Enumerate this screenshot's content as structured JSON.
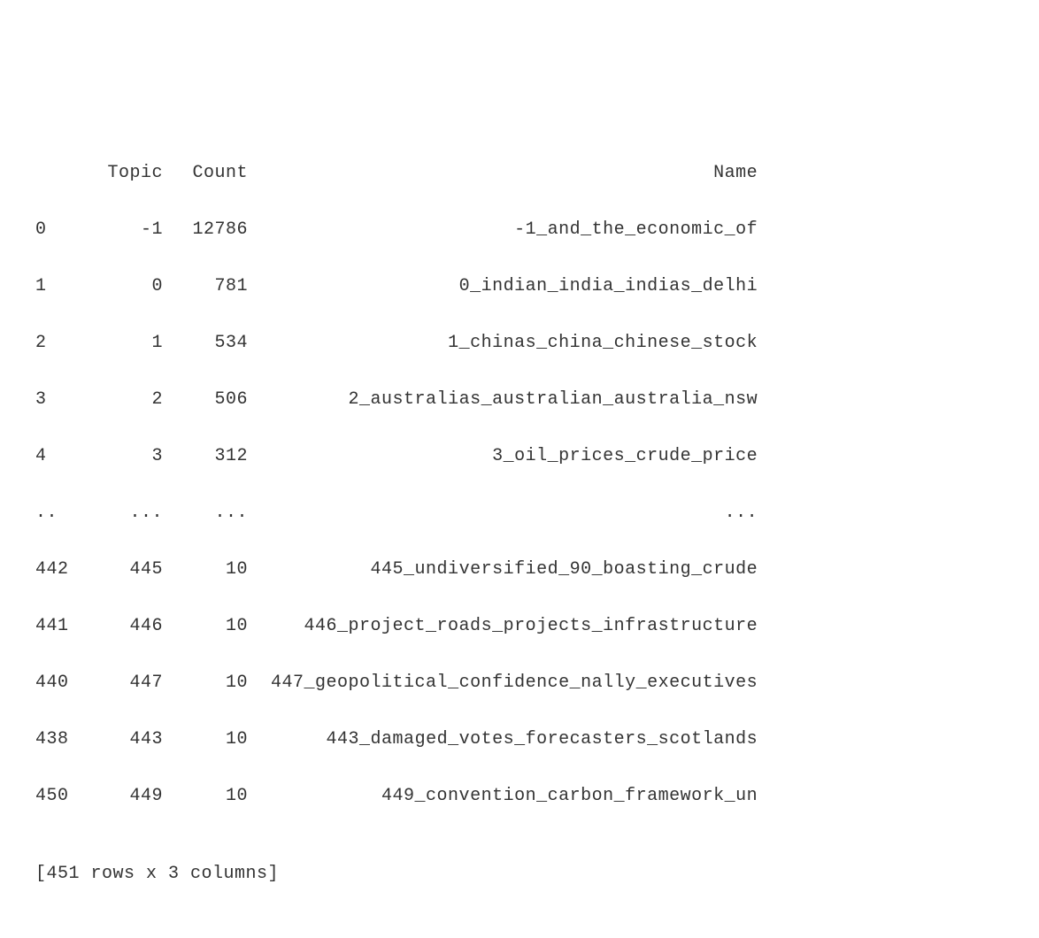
{
  "headers": {
    "topic": "Topic",
    "count": "Count",
    "name": "Name"
  },
  "rows_top": [
    {
      "idx": "0",
      "topic": "-1",
      "count": "12786",
      "name": "-1_and_the_economic_of"
    },
    {
      "idx": "1",
      "topic": "0",
      "count": "781",
      "name": "0_indian_india_indias_delhi"
    },
    {
      "idx": "2",
      "topic": "1",
      "count": "534",
      "name": "1_chinas_china_chinese_stock"
    },
    {
      "idx": "3",
      "topic": "2",
      "count": "506",
      "name": "2_australias_australian_australia_nsw"
    },
    {
      "idx": "4",
      "topic": "3",
      "count": "312",
      "name": "3_oil_prices_crude_price"
    }
  ],
  "ellipsis": {
    "idx": "..",
    "topic": "...",
    "count": "...",
    "name": "..."
  },
  "rows_bottom": [
    {
      "idx": "442",
      "topic": "445",
      "count": "10",
      "name": "445_undiversified_90_boasting_crude"
    },
    {
      "idx": "441",
      "topic": "446",
      "count": "10",
      "name": "446_project_roads_projects_infrastructure"
    },
    {
      "idx": "440",
      "topic": "447",
      "count": "10",
      "name": "447_geopolitical_confidence_nally_executives"
    },
    {
      "idx": "438",
      "topic": "443",
      "count": "10",
      "name": "443_damaged_votes_forecasters_scotlands"
    },
    {
      "idx": "450",
      "topic": "449",
      "count": "10",
      "name": "449_convention_carbon_framework_un"
    }
  ],
  "summary": "[451 rows x 3 columns]"
}
